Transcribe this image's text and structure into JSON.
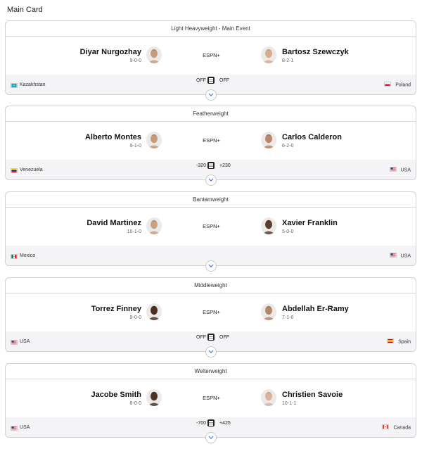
{
  "header": {
    "title": "Main Card"
  },
  "bouts": [
    {
      "weight_class": "Light Heavyweight - Main Event",
      "left": {
        "name": "Diyar Nurgozhay",
        "record": "9-0-0",
        "country": "Kazakhstan",
        "flag": "kz",
        "skin": "#c79a7c",
        "hair": "#2a1d16"
      },
      "right": {
        "name": "Bartosz Szewczyk",
        "record": "8-2-1",
        "country": "Poland",
        "flag": "pl",
        "skin": "#d6ab93",
        "hair": "#6b4a32"
      },
      "broadcast": "ESPN+",
      "odds_left": "OFF",
      "odds_right": "OFF"
    },
    {
      "weight_class": "Featherweight",
      "left": {
        "name": "Alberto Montes",
        "record": "9-1-0",
        "country": "Venezuela",
        "flag": "ve",
        "skin": "#c99a7a",
        "hair": "#1d1410"
      },
      "right": {
        "name": "Carlos Calderon",
        "record": "6-2-0",
        "country": "USA",
        "flag": "us",
        "skin": "#b9876a",
        "hair": "#141010"
      },
      "broadcast": "ESPN+",
      "odds_left": "-320",
      "odds_right": "+230"
    },
    {
      "weight_class": "Bantamweight",
      "left": {
        "name": "David Martinez",
        "record": "10-1-0",
        "country": "Mexico",
        "flag": "mx",
        "skin": "#caa083",
        "hair": "#1a1411"
      },
      "right": {
        "name": "Xavier Franklin",
        "record": "5-0-0",
        "country": "USA",
        "flag": "us",
        "skin": "#5b3b2c",
        "hair": "#1a110d"
      },
      "broadcast": "ESPN+",
      "odds_left": "",
      "odds_right": ""
    },
    {
      "weight_class": "Middleweight",
      "left": {
        "name": "Torrez Finney",
        "record": "9-0-0",
        "country": "USA",
        "flag": "us",
        "skin": "#4a2f24",
        "hair": "#1a110d"
      },
      "right": {
        "name": "Abdellah Er-Ramy",
        "record": "7-1-0",
        "country": "Spain",
        "flag": "es",
        "skin": "#b6866a",
        "hair": "#1b1310"
      },
      "broadcast": "ESPN+",
      "odds_left": "OFF",
      "odds_right": "OFF"
    },
    {
      "weight_class": "Welterweight",
      "left": {
        "name": "Jacobe Smith",
        "record": "8-0-0",
        "country": "USA",
        "flag": "us",
        "skin": "#4d3226",
        "hair": "#160f0b"
      },
      "right": {
        "name": "Christien Savoie",
        "record": "10-1-1",
        "country": "Canada",
        "flag": "ca",
        "skin": "#d8b3a0",
        "hair": "#3a2a22"
      },
      "broadcast": "ESPN+",
      "odds_left": "-700",
      "odds_right": "+425"
    }
  ],
  "colors": {
    "border": "#cfcfd4",
    "footer_bg": "#f4f4f6",
    "text": "#111111",
    "muted": "#666666"
  }
}
